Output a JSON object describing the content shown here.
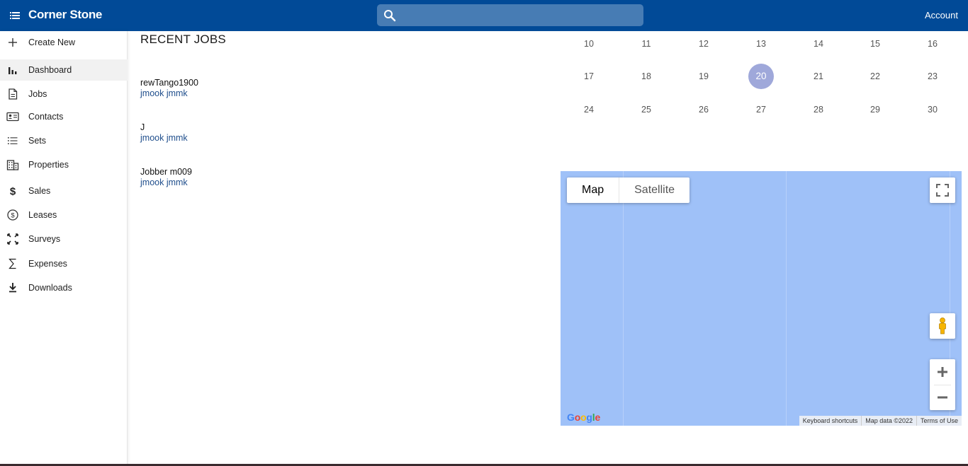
{
  "header": {
    "title": "Corner Stone",
    "search_placeholder": "",
    "account_label": "Account"
  },
  "sidebar": {
    "items": [
      {
        "label": "Create New",
        "icon": "plus-icon"
      },
      {
        "label": "Dashboard",
        "icon": "bar-chart-icon",
        "active": true
      },
      {
        "label": "Jobs",
        "icon": "document-icon"
      },
      {
        "label": "Contacts",
        "icon": "contact-card-icon"
      },
      {
        "label": "Sets",
        "icon": "list-icon"
      },
      {
        "label": "Properties",
        "icon": "building-icon"
      },
      {
        "label": "Sales",
        "icon": "dollar-icon"
      },
      {
        "label": "Leases",
        "icon": "dollar-circle-icon"
      },
      {
        "label": "Surveys",
        "icon": "expand-icon"
      },
      {
        "label": "Expenses",
        "icon": "sigma-icon"
      },
      {
        "label": "Downloads",
        "icon": "download-icon"
      }
    ]
  },
  "recent_jobs": {
    "title": "RECENT JOBS",
    "items": [
      {
        "name": "rewTango1900",
        "owner": "jmook jmmk"
      },
      {
        "name": "J",
        "owner": "jmook jmmk"
      },
      {
        "name": "Jobber m009",
        "owner": "jmook jmmk"
      }
    ]
  },
  "calendar": {
    "today": "20",
    "weeks": [
      [
        "10",
        "11",
        "12",
        "13",
        "14",
        "15",
        "16"
      ],
      [
        "17",
        "18",
        "19",
        "20",
        "21",
        "22",
        "23"
      ],
      [
        "24",
        "25",
        "26",
        "27",
        "28",
        "29",
        "30"
      ]
    ]
  },
  "map": {
    "type_map_label": "Map",
    "type_satellite_label": "Satellite",
    "active_type": "Map",
    "google_logo_text": "Google",
    "attribution": {
      "keyboard": "Keyboard shortcuts",
      "data": "Map data ©2022",
      "terms": "Terms of Use"
    },
    "water_color": "#9fc1f8"
  },
  "colors": {
    "appbar": "#014a97",
    "today_highlight": "#9fa8da",
    "link": "#1f4e8c"
  }
}
